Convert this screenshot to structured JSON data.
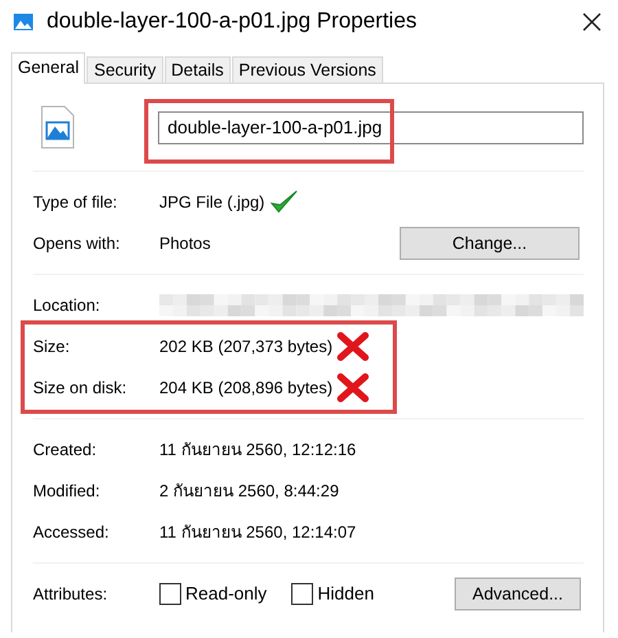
{
  "window": {
    "title": "double-layer-100-a-p01.jpg Properties"
  },
  "tabs": [
    {
      "label": "General",
      "selected": true
    },
    {
      "label": "Security",
      "selected": false
    },
    {
      "label": "Details",
      "selected": false
    },
    {
      "label": "Previous Versions",
      "selected": false
    }
  ],
  "file_name": {
    "value": "double-layer-100-a-p01.jpg",
    "highlighted": true
  },
  "sections": [
    {
      "rows": [
        {
          "kind": "text",
          "label": "Type of file:",
          "value": "JPG File (.jpg)",
          "check_mark": true
        },
        {
          "kind": "app",
          "label": "Opens with:",
          "value": "Photos",
          "button": "Change..."
        }
      ]
    },
    {
      "rows": [
        {
          "kind": "redacted",
          "label": "Location:",
          "highlighted": false
        },
        {
          "kind": "text",
          "label": "Size:",
          "value": "202 KB (207,373 bytes)",
          "cross_mark": true,
          "highlighted": true
        },
        {
          "kind": "text",
          "label": "Size on disk:",
          "value": "204 KB (208,896 bytes)",
          "cross_mark": true,
          "highlighted": true
        }
      ]
    },
    {
      "rows": [
        {
          "kind": "text",
          "label": "Created:",
          "value": "11 กันยายน 2560, 12:12:16"
        },
        {
          "kind": "text",
          "label": "Modified:",
          "value": "2 กันยายน 2560, 8:44:29"
        },
        {
          "kind": "text",
          "label": "Accessed:",
          "value": "11 กันยายน 2560, 12:14:07"
        }
      ]
    }
  ],
  "attributes": {
    "label": "Attributes:",
    "checkboxes": [
      {
        "label": "Read-only",
        "checked": false
      },
      {
        "label": "Hidden",
        "checked": false
      }
    ],
    "button": "Advanced..."
  }
}
